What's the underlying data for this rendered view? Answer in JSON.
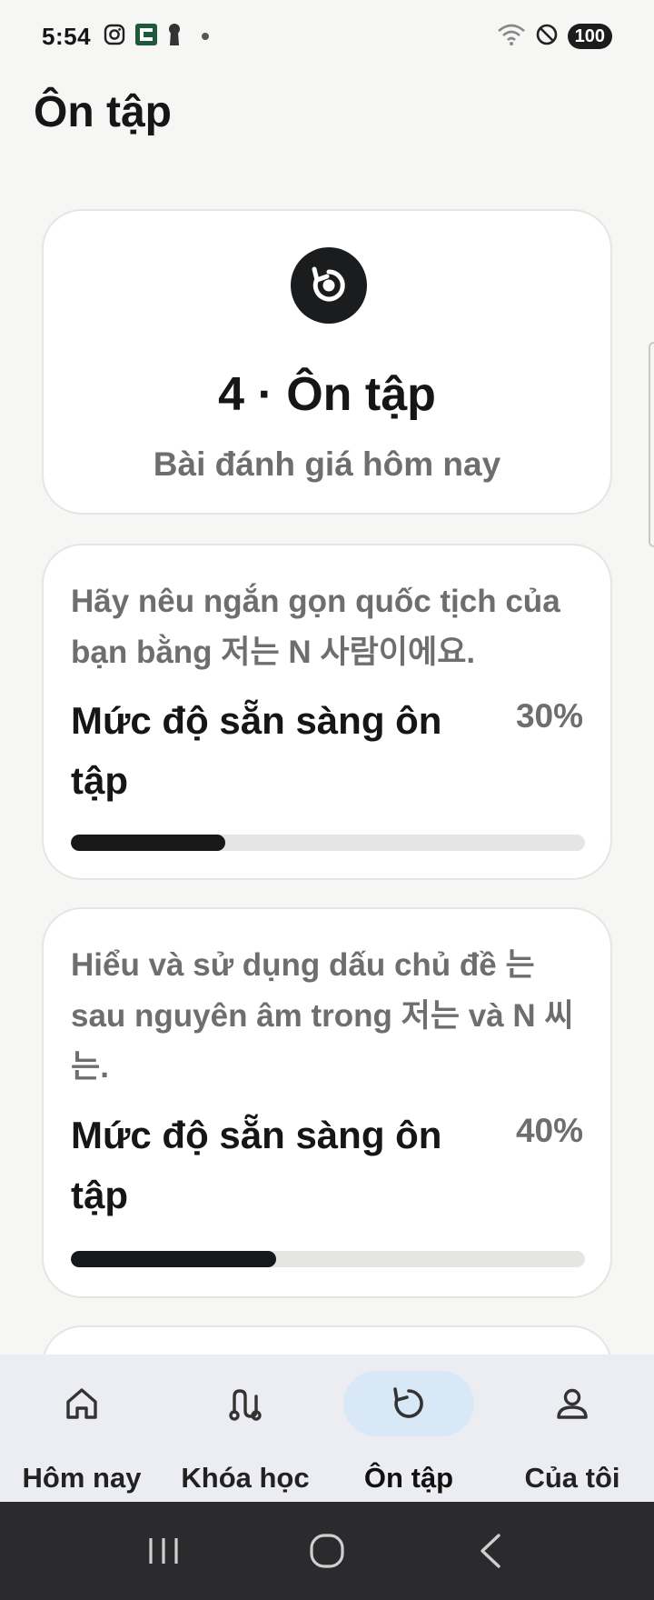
{
  "status_bar": {
    "time": "5:54",
    "battery": "100",
    "left_icons": [
      "instagram-icon",
      "app-badge-icon",
      "keyhole-icon",
      "dot-icon"
    ],
    "right_icons": [
      "wifi-icon",
      "do-not-disturb-icon",
      "battery-icon"
    ]
  },
  "page": {
    "title": "Ôn tập"
  },
  "hero": {
    "icon": "review-refresh-icon",
    "title": "4 · Ôn tập",
    "subtitle": "Bài đánh giá hôm nay"
  },
  "review_items": [
    {
      "description": "Hãy nêu ngắn gọn quốc tịch của bạn bằng 저는 N 사람이에요.",
      "readiness_label": "Mức độ sẵn sàng ôn tập",
      "readiness_percent": "30%",
      "readiness_value": 0.3
    },
    {
      "description": "Hiểu và sử dụng dấu chủ đề 는 sau nguyên âm trong 저는 và N 씨는.",
      "readiness_label": "Mức độ sẵn sàng ôn tập",
      "readiness_percent": "40%",
      "readiness_value": 0.4
    }
  ],
  "bottom_nav": {
    "items": [
      {
        "label": "Hôm nay",
        "icon": "home-icon",
        "active": false
      },
      {
        "label": "Khóa học",
        "icon": "path-icon",
        "active": false
      },
      {
        "label": "Ôn tập",
        "icon": "review-icon",
        "active": true
      },
      {
        "label": "Của tôi",
        "icon": "profile-icon",
        "active": false
      }
    ]
  },
  "colors": {
    "background": "#f6f6f4",
    "card": "#ffffff",
    "accent_dark": "#17181a",
    "muted_text": "#6d6e70",
    "nav_background": "#ecedf2",
    "nav_active_pill": "#d8e8f6"
  }
}
